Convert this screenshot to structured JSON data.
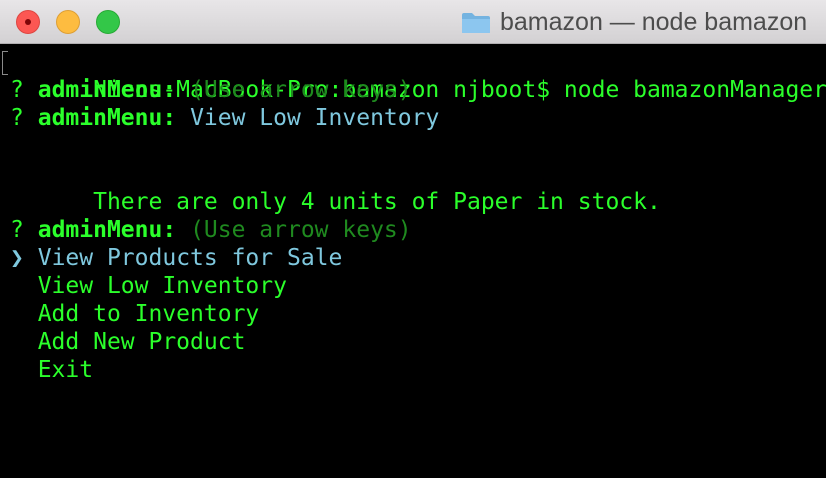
{
  "window": {
    "title": "bamazon — node bamazon"
  },
  "terminal": {
    "prompt": "Nicos-MacBook-Pro:bamazon njboot$ node bamazonManager.js",
    "q1": {
      "mark": "?",
      "name": "adminMenu:",
      "hint": "(Use arrow keys)"
    },
    "q2": {
      "mark": "?",
      "name": "adminMenu:",
      "answer": "View Low Inventory"
    },
    "message": "There are only 4 units of Paper in stock.",
    "q3": {
      "mark": "?",
      "name": "adminMenu:",
      "hint": "(Use arrow keys)"
    },
    "pointer": "❯",
    "options": [
      "View Products for Sale",
      "View Low Inventory",
      "Add to Inventory",
      "Add New Product",
      "Exit"
    ],
    "selected_index": 0
  },
  "colors": {
    "terminal_green": "#2bff2b",
    "hint_green": "#1f8a1f",
    "selection_cyan": "#7fc8de",
    "close": "#fc5753",
    "minimize": "#fdbc40",
    "maximize": "#33c748"
  },
  "icons": [
    "close-icon",
    "folder-icon"
  ]
}
